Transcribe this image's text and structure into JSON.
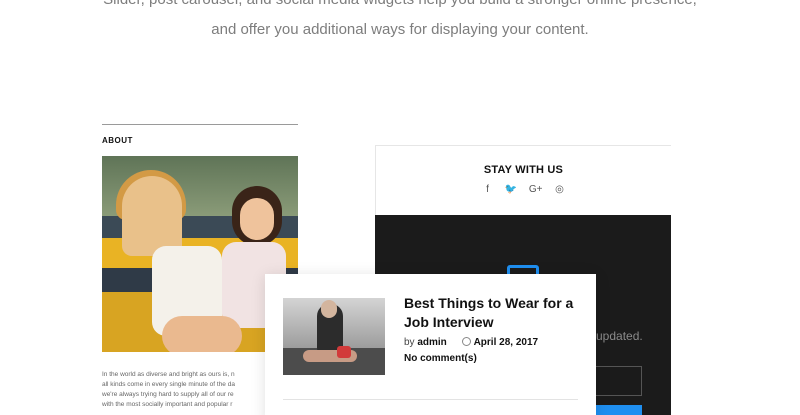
{
  "intro": {
    "line1": "Slider, post carousel, and social media widgets help you build a stronger online presence,",
    "line2": "and offer you additional ways for displaying your content."
  },
  "about_widget": {
    "title": "ABOUT",
    "text_lines": [
      "In the world as diverse and bright as ours is, n",
      "all kinds come in every single minute of the da",
      "we're always trying hard to supply all of our re",
      "with the most socially important and popular r"
    ]
  },
  "stay_widget": {
    "title": "STAY WITH US",
    "social_icons": [
      "facebook-icon",
      "twitter-icon",
      "google-plus-icon",
      "instagram-icon"
    ],
    "social_glyphs": [
      "f",
      "🐦",
      "G+",
      "◎"
    ],
    "partial_text": "updated."
  },
  "popup_post": {
    "title": "Best Things to Wear for a Job Interview",
    "by_label": "by",
    "author": "admin",
    "date": "April 28, 2017",
    "comments": "No comment(s)"
  },
  "colors": {
    "accent": "#1f8ff0",
    "dark_panel": "#1b1b1b"
  }
}
